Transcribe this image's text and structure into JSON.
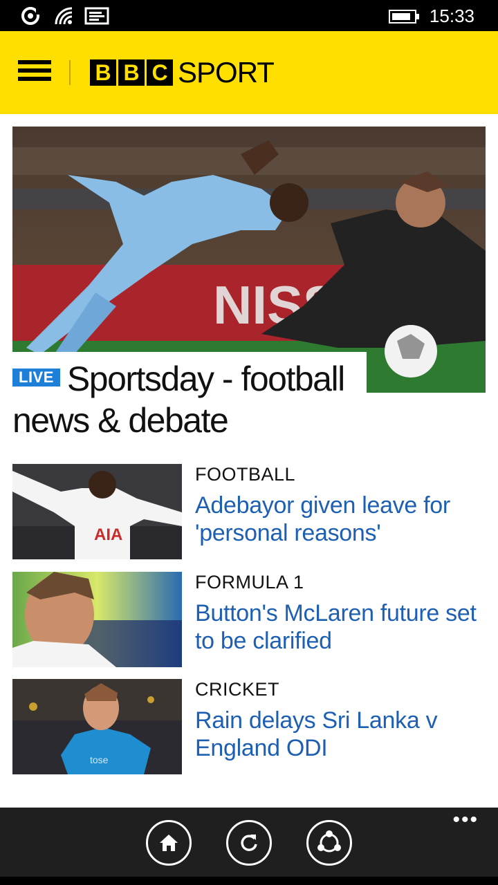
{
  "status_bar": {
    "time": "15:33",
    "icons": [
      "data-sense-icon",
      "wifi-icon",
      "message-icon",
      "battery-icon"
    ]
  },
  "header": {
    "logo_letters": [
      "B",
      "B",
      "C"
    ],
    "logo_word": "SPORT",
    "brand_color": "#ffdf00"
  },
  "hero": {
    "badge": "LIVE",
    "title": "Sportsday - football news & debate",
    "image": "football-match-photo"
  },
  "stories": [
    {
      "category": "FOOTBALL",
      "headline": "Adebayor given leave for 'personal reasons'",
      "image": "footballer-photo"
    },
    {
      "category": "FORMULA 1",
      "headline": "Button's McLaren future set to be clarified",
      "image": "driver-photo"
    },
    {
      "category": "CRICKET",
      "headline": "Rain delays Sri Lanka v England ODI",
      "image": "cricketer-photo"
    }
  ],
  "app_bar": {
    "buttons": [
      "home-icon",
      "refresh-icon",
      "share-icon"
    ],
    "more": "•••"
  },
  "colors": {
    "accent": "#1d7fd8",
    "headline": "#1d5fb2"
  }
}
